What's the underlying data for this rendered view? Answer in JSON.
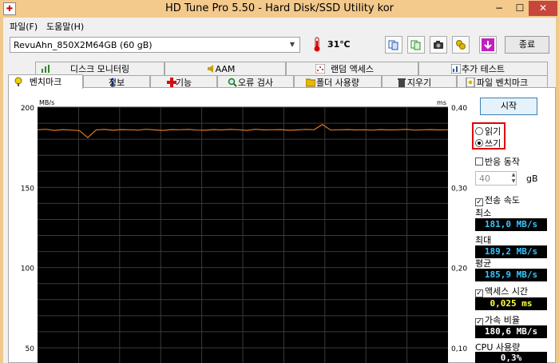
{
  "window": {
    "title": "HD Tune Pro 5.50 - Hard Disk/SSD Utility kor",
    "close_glyph": "✕",
    "minimize_glyph": "−",
    "maximize_glyph": "☐"
  },
  "menu": {
    "file": "파일(F)",
    "help": "도움말(H)"
  },
  "toolbar": {
    "drive": "RevuAhn_850X2M64GB (60 gB)",
    "temperature": "31℃",
    "exit_label": "종료",
    "icons": [
      "copy-icon",
      "copy-info-icon",
      "camera-icon",
      "options-icon",
      "save-icon"
    ]
  },
  "tabs": {
    "top": [
      "디스크 모니터링",
      "AAM",
      "랜덤 액세스",
      "추가 테스트"
    ],
    "bottom": [
      "벤치마크",
      "정보",
      "기능",
      "오류 검사",
      "폴더 사용량",
      "지우기",
      "파일 벤치마크"
    ],
    "active": "벤치마크"
  },
  "chart_data": {
    "type": "line",
    "y_left_unit": "MB/s",
    "y_right_unit": "ms",
    "y_left_ticks": [
      "200",
      "150",
      "100",
      "50"
    ],
    "y_right_ticks": [
      "0,40",
      "0,30",
      "0,20",
      "0,10"
    ],
    "y_left_visible_range": [
      40,
      200
    ],
    "y_right_visible_range": [
      0.08,
      0.4
    ],
    "grid": true,
    "background": "#000000",
    "series": [
      {
        "name": "전송 속도",
        "color": "#e07820",
        "values": [
          185.9,
          186.2,
          185.5,
          186.0,
          185.7,
          185.4,
          181.0,
          185.8,
          186.1,
          185.6,
          186.0,
          185.9,
          185.7,
          186.2,
          185.8,
          185.5,
          186.0,
          185.9,
          186.1,
          185.7,
          185.6,
          186.0,
          185.8,
          186.1,
          185.9,
          185.5,
          186.2,
          185.8,
          185.9,
          186.0,
          185.6,
          185.8,
          186.1,
          185.9,
          189.2,
          185.7,
          185.9,
          186.0,
          185.8,
          185.9,
          185.7,
          186.0,
          185.8,
          185.9,
          186.1,
          185.7,
          185.9,
          186.0,
          185.8,
          185.9
        ]
      }
    ]
  },
  "sidebar": {
    "start_label": "시작",
    "read_label": "읽기",
    "write_label": "쓰기",
    "write_selected": true,
    "read_selected": false,
    "short_stroke_label": "반응 동작",
    "short_stroke_value": "40",
    "short_stroke_unit": "gB",
    "transfer_rate_label": "전송 속도",
    "min_label": "최소",
    "min_value": "181,0 MB/s",
    "max_label": "최대",
    "max_value": "189,2 MB/s",
    "avg_label": "평균",
    "avg_value": "185,9 MB/s",
    "access_time_label": "액세스 시간",
    "access_time_value": "0,025 ms",
    "burst_rate_label": "가속 비율",
    "burst_rate_value": "180,6 MB/s",
    "cpu_label": "CPU 사용량",
    "cpu_value": "0,3%",
    "check_mark": "✓",
    "colors": {
      "cyan": "#35c8ff",
      "yellow": "#ffff40",
      "white": "#ffffff"
    }
  }
}
